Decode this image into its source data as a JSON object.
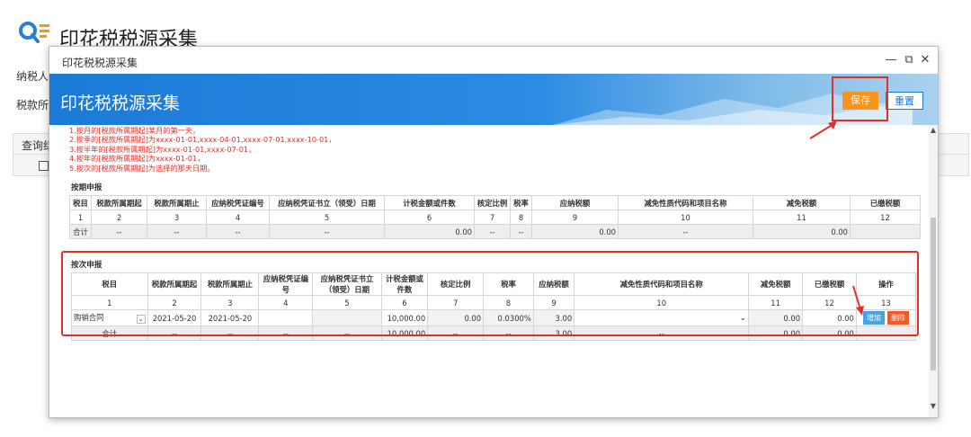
{
  "background": {
    "title": "印花税税源采集",
    "label1": "纳税人识",
    "label2": "税款所属",
    "grid_label": "查询结"
  },
  "modal": {
    "title": "印花税税源采集",
    "banner_title": "印花税税源采集",
    "save_label": "保存",
    "reset_label": "重置",
    "win_min": "—",
    "win_max": "⧉",
    "win_close": "✕"
  },
  "notes": [
    "1.按月的[税款所属期起]某月的第一天，",
    "2.按季的[税款所属期起]为xxxx-01-01,xxxx-04-01,xxxx-07-01,xxxx-10-01，",
    "3.按半年的[税款所属期起]为xxxx-01-01,xxxx-07-01，",
    "4.按年的[税款所属期起]为xxxx-01-01，",
    "5.按次的[税款所属期起]为选择的那天日期。"
  ],
  "periodic": {
    "title": "按期申报",
    "headers": [
      "税目",
      "税款所属期起",
      "税款所属期止",
      "应纳税凭证编号",
      "应纳税凭证书立（领受）日期",
      "计税金额或件数",
      "核定比例",
      "税率",
      "应纳税额",
      "减免性质代码和项目名称",
      "减免税额",
      "已缴税额"
    ],
    "numbers": [
      "1",
      "2",
      "3",
      "4",
      "5",
      "6",
      "7",
      "8",
      "9",
      "10",
      "11",
      "12"
    ],
    "total_row": [
      "合计",
      "--",
      "--",
      "--",
      "--",
      "0.00",
      "--",
      "--",
      "0.00",
      "--",
      "0.00",
      ""
    ]
  },
  "per_time": {
    "title": "按次申报",
    "headers": [
      "税目",
      "税款所属期起",
      "税款所属期止",
      "应纳税凭证编号",
      "应纳税凭证书立（领受）日期",
      "计税金额或件数",
      "核定比例",
      "税率",
      "应纳税额",
      "减免性质代码和项目名称",
      "减免税额",
      "已缴税额",
      "操作"
    ],
    "numbers": [
      "1",
      "2",
      "3",
      "4",
      "5",
      "6",
      "7",
      "8",
      "9",
      "10",
      "11",
      "12",
      "13"
    ],
    "row": {
      "tax_item": "购销合同",
      "start": "2021-05-20",
      "end": "2021-05-20",
      "voucher_no": "",
      "sign_date": "",
      "amount": "10,000.00",
      "ratio": "0.00",
      "rate": "0.0300%",
      "tax": "3.00",
      "exemption": "",
      "exempt_tax": "0.00",
      "paid_tax": "0.00",
      "add_label": "增加",
      "del_label": "删除"
    },
    "total_row": [
      "合计",
      "--",
      "--",
      "--",
      "--",
      "10,000.00",
      "--",
      "--",
      "3.00",
      "--",
      "0.00",
      "0.00",
      ""
    ]
  }
}
